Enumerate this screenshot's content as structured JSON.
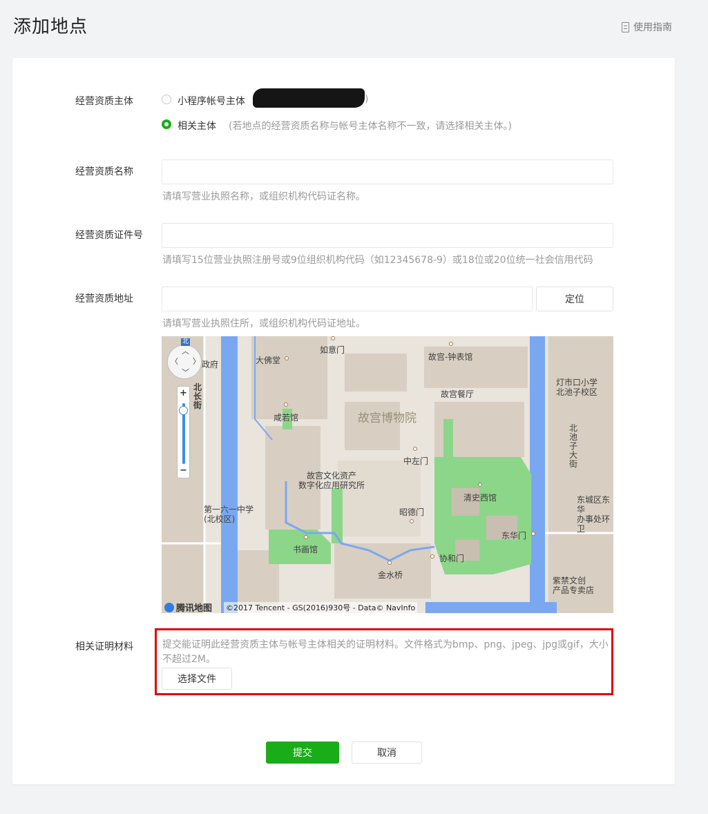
{
  "header": {
    "title": "添加地点",
    "guide_label": "使用指南"
  },
  "form": {
    "subject": {
      "label": "经营资质主体",
      "option_mini_program": "小程序帐号主体",
      "option_mini_program_close": ")",
      "option_related": "相关主体",
      "option_related_hint": "(若地点的经营资质名称与帐号主体名称不一致，请选择相关主体。)",
      "selected": "相关主体"
    },
    "name": {
      "label": "经营资质名称",
      "value": "",
      "hint": "请填写营业执照名称，或组织机构代码证名称。"
    },
    "license": {
      "label": "经营资质证件号",
      "value": "",
      "hint": "请填写15位营业执照注册号或9位组织机构代码（如12345678-9）或18位或20位统一社会信用代码"
    },
    "address": {
      "label": "经营资质地址",
      "value": "",
      "locate_button": "定位",
      "hint": "请填写营业执照住所，或组织机构代码证地址。"
    },
    "material": {
      "label": "相关证明材料",
      "hint": "提交能证明此经营资质主体与帐号主体相关的证明材料。文件格式为bmp、png、jpeg、jpg或gif，大小不超过2M。",
      "choose_file_button": "选择文件"
    }
  },
  "map": {
    "compass_label": "北",
    "zoom_in": "+",
    "zoom_out": "−",
    "places": {
      "gugong": "故宫博物院",
      "ruyimen": "如意门",
      "dafotang": "大佛堂",
      "zhongbiaoguan": "故宫-钟表馆",
      "zhengfu": "政府",
      "canting": "故宫餐厅",
      "dengshikou": "灯市口小学\n北池子校区",
      "xianruoguan": "咸若馆",
      "beichangjie": "北\n长\n街",
      "beichizi": "北\n池\n子\n大\n街",
      "zhongzuomen": "中左门",
      "wenhuazichan": "故宫文化资产\n数字化应用研究所",
      "qingshixiguan": "清史西馆",
      "dongcheng": "东城区东华\n办事处环卫",
      "school161": "第一六一中学\n(北校区)",
      "zhaodemen": "昭德门",
      "donghuamen": "东华门",
      "shuhuaguan": "书画馆",
      "xiehemen": "协和门",
      "jinshuiqiao": "金水桥",
      "zijincheng": "紫禁文创\n产品专卖店"
    },
    "logo": "腾讯地图",
    "copyright": "©2017 Tencent - GS(2016)930号 - Data© NavInfo",
    "colors": {
      "water": "#7aa8f0",
      "green": "#8cd68a",
      "building": "#d8cfc2",
      "ground": "#e9e4dc"
    }
  },
  "actions": {
    "submit": "提交",
    "cancel": "取消"
  },
  "colors": {
    "primary": "#1aad19",
    "highlight_border": "#e00000"
  }
}
